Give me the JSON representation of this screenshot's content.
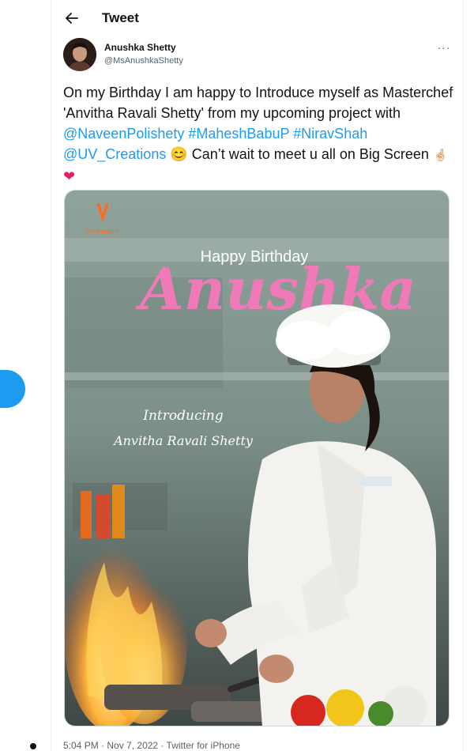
{
  "header": {
    "title": "Tweet"
  },
  "author": {
    "name": "Anushka Shetty",
    "handle": "@MsAnushkaShetty"
  },
  "tweet": {
    "text_1": "On my Birthday I am happy to Introduce myself as Masterchef 'Anvitha Ravali Shetty' from my upcoming project with ",
    "mention_1": "@NaveenPolishety",
    "hashtag_1": "#MaheshBabuP",
    "hashtag_2": "#NiravShah",
    "mention_2": "@UV_Creations",
    "text_2": " Can’t wait to meet u all on Big Screen "
  },
  "media": {
    "logo_text": "UV creations",
    "headline": "Happy Birthday",
    "name_script": "Anushka",
    "intro_line1": "Introducing",
    "intro_line2": "Anvitha Ravali Shetty"
  },
  "meta": {
    "time": "5:04 PM",
    "sep_1": " · ",
    "date": "Nov 7, 2022",
    "sep_2": " · ",
    "source": "Twitter for iPhone"
  },
  "colors": {
    "accent": "#1d9bf0",
    "pink_script": "#f07ab8"
  },
  "icons": [
    "back-arrow-icon",
    "more-icon",
    "smiling-face-icon",
    "crossed-fingers-icon",
    "red-heart-icon"
  ]
}
